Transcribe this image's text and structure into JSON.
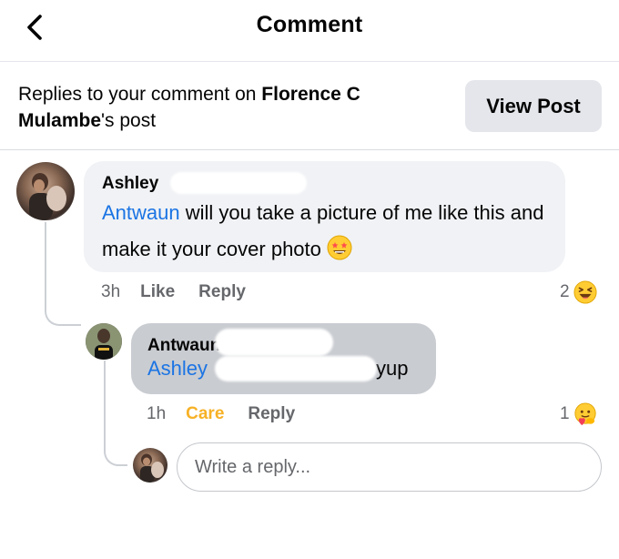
{
  "header": {
    "title": "Comment",
    "back_icon": "chevron-left-icon"
  },
  "context": {
    "prefix": "Replies to your comment on ",
    "post_owner": "Florence C Mulambe",
    "suffix": "'s post",
    "view_post_label": "View Post"
  },
  "comment": {
    "author": "Ashley",
    "mention": "Antwaun",
    "text": " will you take a picture of me like this and make it your cover photo",
    "emoji": "star-struck-emoji",
    "time": "3h",
    "like_label": "Like",
    "reply_label": "Reply",
    "reaction_count": "2",
    "reaction": "laughing-emoji"
  },
  "reply": {
    "author": "Antwaun",
    "mention": "Ashley",
    "text": "yup",
    "time": "1h",
    "care_label": "Care",
    "reply_label": "Reply",
    "reaction_count": "1",
    "reaction": "care-emoji"
  },
  "composer": {
    "placeholder": "Write a reply..."
  },
  "colors": {
    "link": "#1b74e4",
    "care": "#f7b125",
    "bubble": "#f0f2f5",
    "bubble_highlight": "#c9ccd1"
  }
}
